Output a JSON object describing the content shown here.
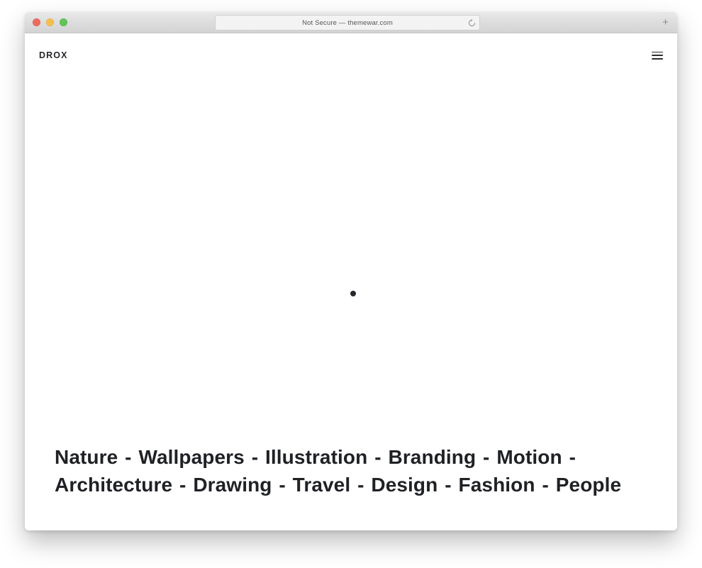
{
  "browser": {
    "url_bar": {
      "text": "Not Secure — themewar.com",
      "security_label": "Not Secure",
      "domain": "themewar.com"
    },
    "reload_label": "Reload",
    "new_tab_label": "+",
    "traffic_lights": [
      {
        "name": "close",
        "color": "#ed6a5e"
      },
      {
        "name": "minimize",
        "color": "#f5bf4f"
      },
      {
        "name": "zoom",
        "color": "#61c454"
      }
    ]
  },
  "page": {
    "brand": "DROX",
    "menu_label": "Menu",
    "hero_text": "Nature - Wallpapers - Illustration - Branding - Motion - Architecture - Drawing - Travel - Design - Fashion - People",
    "categories": [
      "Nature",
      "Wallpapers",
      "Illustration",
      "Branding",
      "Motion",
      "Architecture",
      "Drawing",
      "Travel",
      "Design",
      "Fashion",
      "People"
    ],
    "separator": "-",
    "colors": {
      "text": "#1f2125",
      "background": "#ffffff",
      "loader_dot": "#25272b"
    }
  }
}
